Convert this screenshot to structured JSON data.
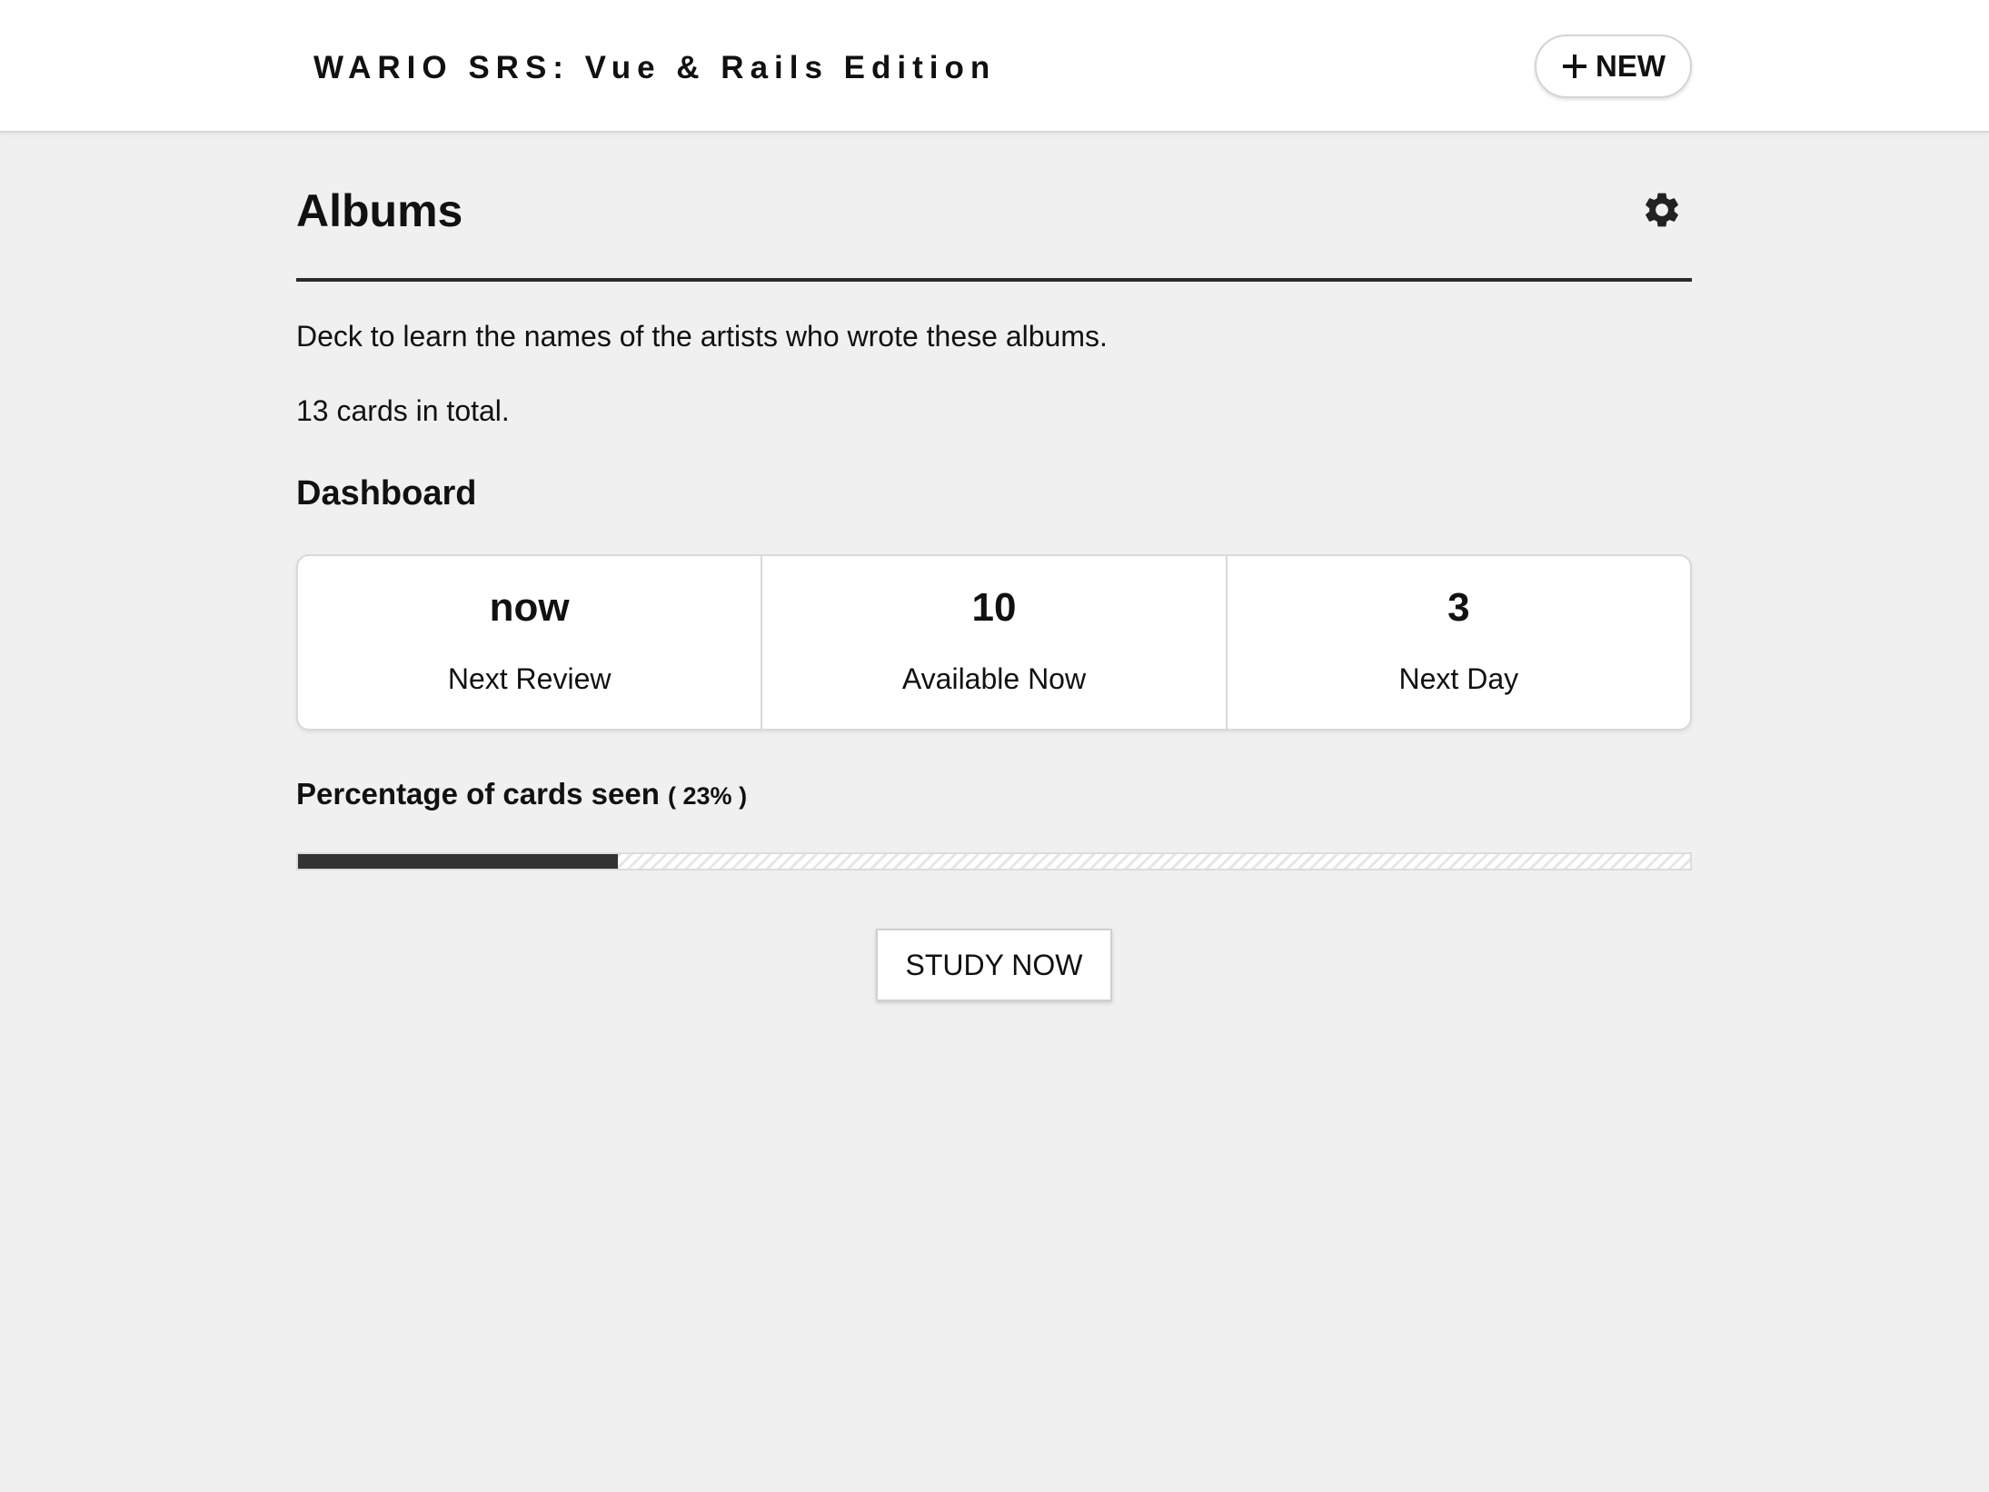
{
  "header": {
    "brand": "WARIO SRS: Vue & Rails Edition",
    "new_button_label": "NEW",
    "new_button_icon": "plus-icon"
  },
  "deck": {
    "title": "Albums",
    "settings_icon": "gear-icon",
    "description": "Deck to learn the names of the artists who wrote these albums.",
    "total_text": "13 cards in total."
  },
  "dashboard": {
    "title": "Dashboard",
    "stats": [
      {
        "value": "now",
        "label": "Next Review"
      },
      {
        "value": "10",
        "label": "Available Now"
      },
      {
        "value": "3",
        "label": "Next Day"
      }
    ]
  },
  "progress": {
    "title": "Percentage of cards seen",
    "percent_text": "( 23% )",
    "percent": 23,
    "fill_color": "#333333"
  },
  "actions": {
    "study_label": "STUDY NOW"
  }
}
